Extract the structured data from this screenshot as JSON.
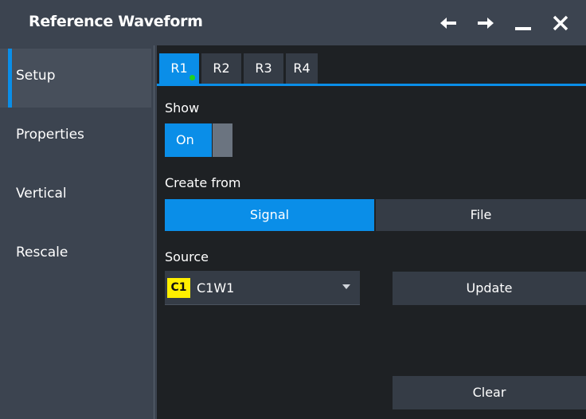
{
  "window": {
    "title": "Reference Waveform",
    "icons": [
      "arrow-left-icon",
      "arrow-right-icon",
      "minimize-icon",
      "close-icon"
    ]
  },
  "sidebar": {
    "items": [
      {
        "label": "Setup",
        "active": true
      },
      {
        "label": "Properties",
        "active": false
      },
      {
        "label": "Vertical",
        "active": false
      },
      {
        "label": "Rescale",
        "active": false
      }
    ]
  },
  "tabs": [
    {
      "label": "R1",
      "active": true
    },
    {
      "label": "R2",
      "active": false
    },
    {
      "label": "R3",
      "active": false
    },
    {
      "label": "R4",
      "active": false
    }
  ],
  "setup": {
    "show_label": "Show",
    "show_toggle": {
      "value": "On",
      "enabled": true
    },
    "create_from_label": "Create from",
    "create_from_options": [
      {
        "label": "Signal",
        "selected": true
      },
      {
        "label": "File",
        "selected": false
      }
    ],
    "source_label": "Source",
    "source": {
      "badge": "C1",
      "value": "C1W1"
    },
    "update_button": "Update",
    "clear_button": "Clear"
  },
  "colors": {
    "accent": "#0a8ee8",
    "panel": "#3c4450",
    "background": "#1e2124",
    "control": "#353c46",
    "channel_badge": "#ffef00",
    "status_dot": "#1fd21f"
  }
}
